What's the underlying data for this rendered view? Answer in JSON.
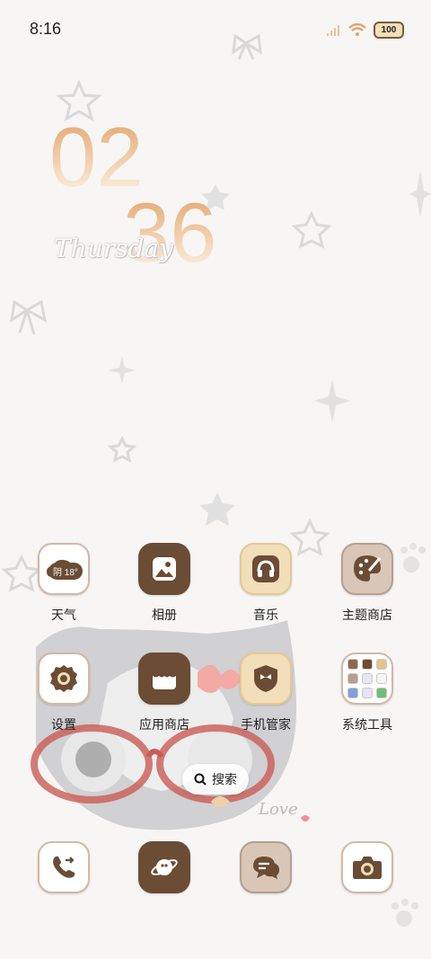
{
  "status_bar": {
    "time": "8:16",
    "battery": "100",
    "icons": [
      "signal-icon",
      "wifi-icon",
      "battery-icon"
    ]
  },
  "clock": {
    "hour": "02",
    "minute": "36",
    "weekday": "Thursday"
  },
  "weather_widget": {
    "condition": "阴",
    "temperature": "18°"
  },
  "apps": [
    {
      "label": "天气",
      "icon": "weather-icon"
    },
    {
      "label": "相册",
      "icon": "gallery-icon"
    },
    {
      "label": "音乐",
      "icon": "music-icon"
    },
    {
      "label": "主题商店",
      "icon": "theme-store-icon"
    },
    {
      "label": "设置",
      "icon": "settings-icon"
    },
    {
      "label": "应用商店",
      "icon": "app-store-icon"
    },
    {
      "label": "手机管家",
      "icon": "phone-manager-icon"
    },
    {
      "label": "系统工具",
      "icon": "system-tools-folder-icon"
    }
  ],
  "search": {
    "label": "搜索",
    "icon": "search-icon"
  },
  "dock": [
    {
      "name": "phone",
      "icon": "phone-icon"
    },
    {
      "name": "browser",
      "icon": "browser-icon"
    },
    {
      "name": "messages",
      "icon": "messages-icon"
    },
    {
      "name": "camera",
      "icon": "camera-icon"
    }
  ],
  "colors": {
    "brown": "#6b4c35",
    "cream": "#f2deb8",
    "tan": "#d9c6b6",
    "clock_gradient_top": "#e3a46c"
  }
}
